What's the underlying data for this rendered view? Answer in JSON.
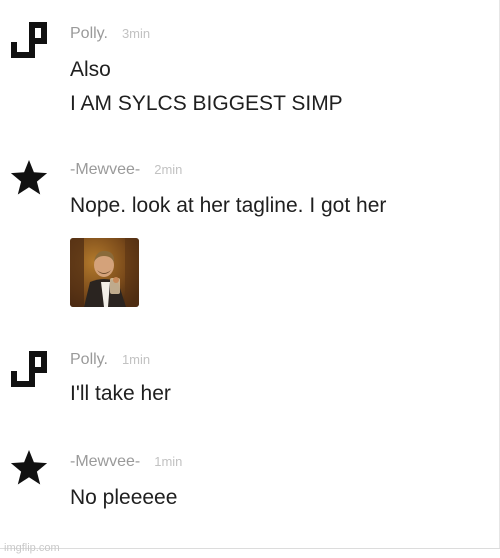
{
  "messages": [
    {
      "username": "Polly.",
      "time": "3min",
      "avatar_icon": "pixel-p-icon",
      "lines": [
        "Also",
        "I AM SYLCS BIGGEST SIMP"
      ]
    },
    {
      "username": "-Mewvee-",
      "time": "2min",
      "avatar_icon": "star-icon",
      "lines": [
        "Nope. look at her tagline. I got her"
      ],
      "attachment": "laughing-man-meme-thumbnail"
    },
    {
      "username": "Polly.",
      "time": "1min",
      "avatar_icon": "pixel-p-icon",
      "lines": [
        "I'll take her"
      ]
    },
    {
      "username": "-Mewvee-",
      "time": "1min",
      "avatar_icon": "star-icon",
      "lines": [
        "No pleeeee"
      ]
    }
  ],
  "watermark": "imgflip.com",
  "colors": {
    "username": "#9a9a9a",
    "timestamp": "#c2c2c2",
    "message_text": "#1f1f1f",
    "avatar": "#111111"
  }
}
